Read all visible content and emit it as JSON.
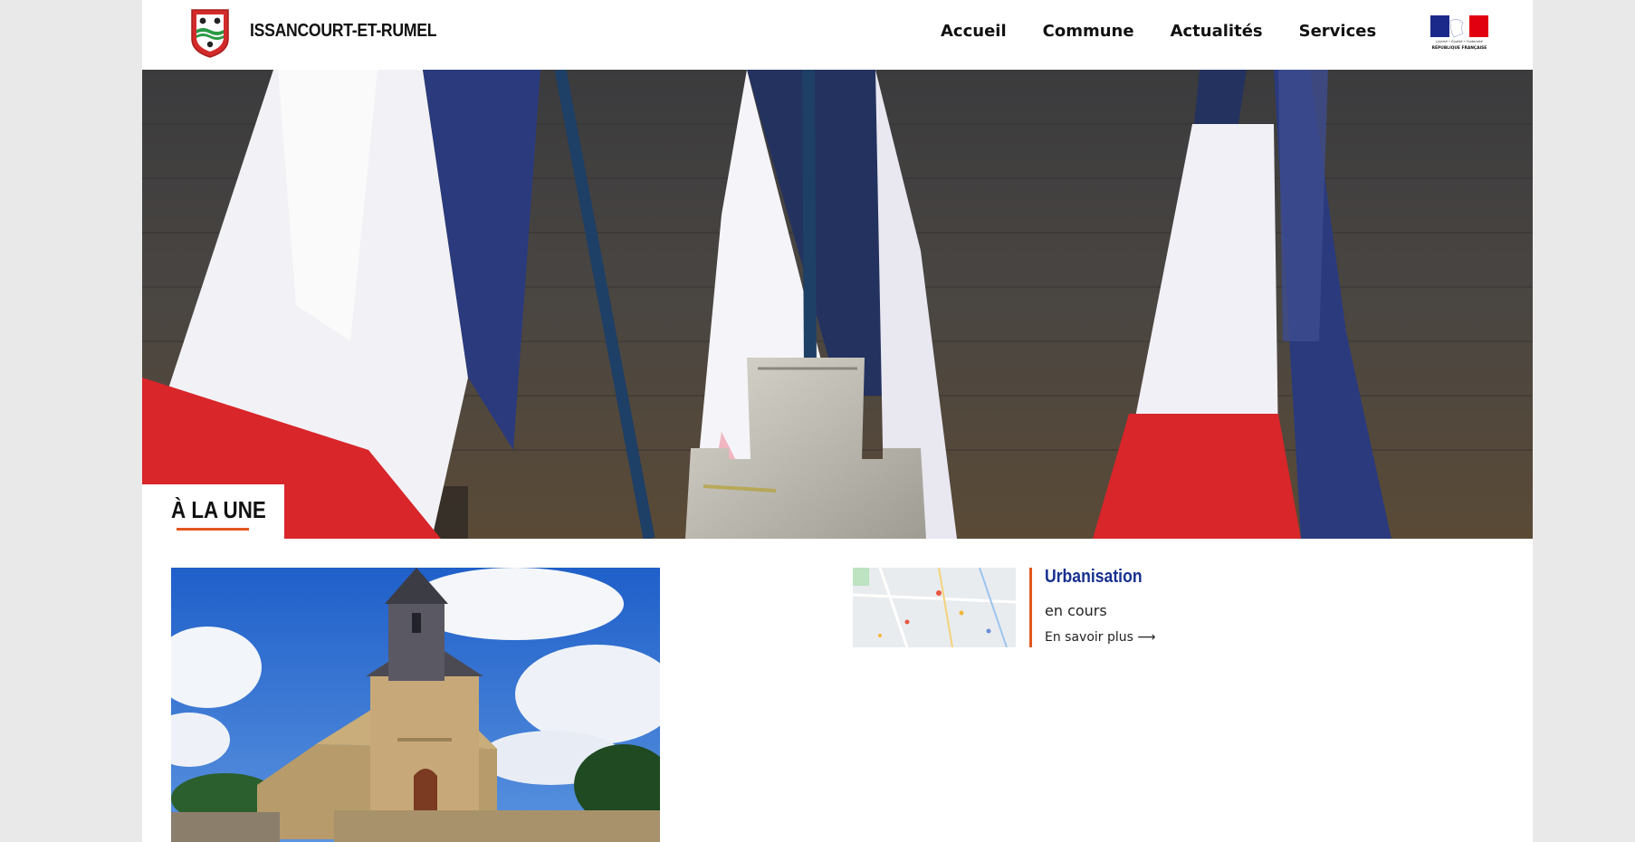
{
  "header": {
    "site_name": "ISSANCOURT-ET-RUMEL",
    "nav": [
      {
        "label": "Accueil"
      },
      {
        "label": "Commune"
      },
      {
        "label": "Actualités"
      },
      {
        "label": "Services"
      }
    ],
    "marianne": {
      "motto": "Liberté • Égalité • Fraternité",
      "caption": "RÉPUBLIQUE FRANÇAISE"
    }
  },
  "section": {
    "title": "À LA UNE"
  },
  "news_card": {
    "title": "Urbanisation",
    "subtitle": "en cours",
    "link_label": "En savoir plus ⟶"
  },
  "colors": {
    "accent_orange": "#e2571e",
    "title_blue": "#17308f",
    "flag_blue": "#1b2a66",
    "flag_red": "#d8262a",
    "page_background": "#e9e9e9"
  },
  "icons": [
    "commune-crest-icon",
    "marianne-logo-icon",
    "arrow-right-icon"
  ]
}
